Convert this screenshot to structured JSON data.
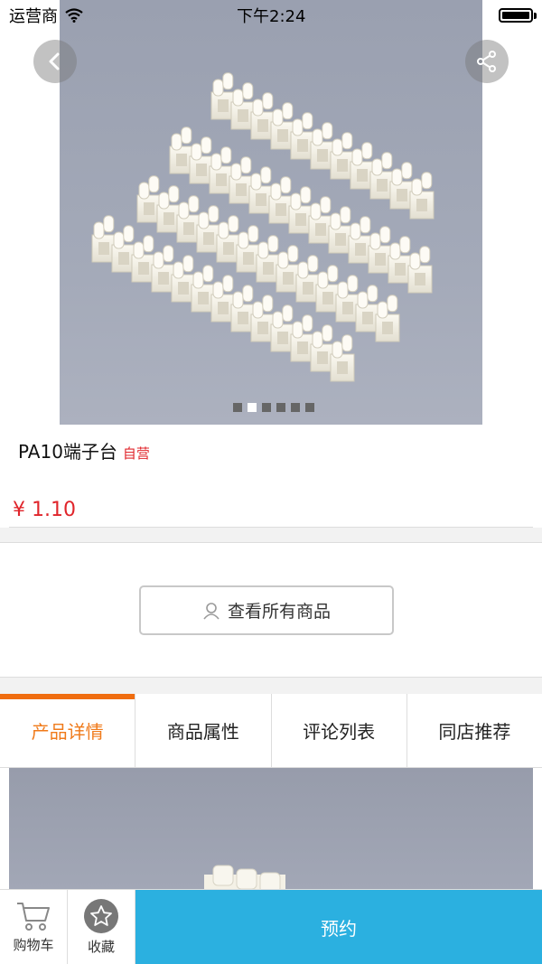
{
  "status": {
    "carrier": "运营商",
    "time": "下午2:24"
  },
  "product": {
    "title": "PA10端子台",
    "self_tag": "自营",
    "price": "¥ 1.10"
  },
  "carousel": {
    "slides": 6,
    "active_index": 1
  },
  "store": {
    "all_goods_label": "查看所有商品"
  },
  "tabs": [
    {
      "label": "产品详情",
      "active": true
    },
    {
      "label": "商品属性",
      "active": false
    },
    {
      "label": "评论列表",
      "active": false
    },
    {
      "label": "同店推荐",
      "active": false
    }
  ],
  "bottom_bar": {
    "cart_label": "购物车",
    "favorite_label": "收藏",
    "reserve_label": "预约"
  },
  "colors": {
    "accent_orange": "#f06d10",
    "price_red": "#e0252b",
    "reserve_blue": "#2bb0e0"
  },
  "icons": [
    "back-icon",
    "share-icon",
    "user-icon",
    "cart-icon",
    "star-icon",
    "wifi-icon",
    "battery-icon"
  ]
}
